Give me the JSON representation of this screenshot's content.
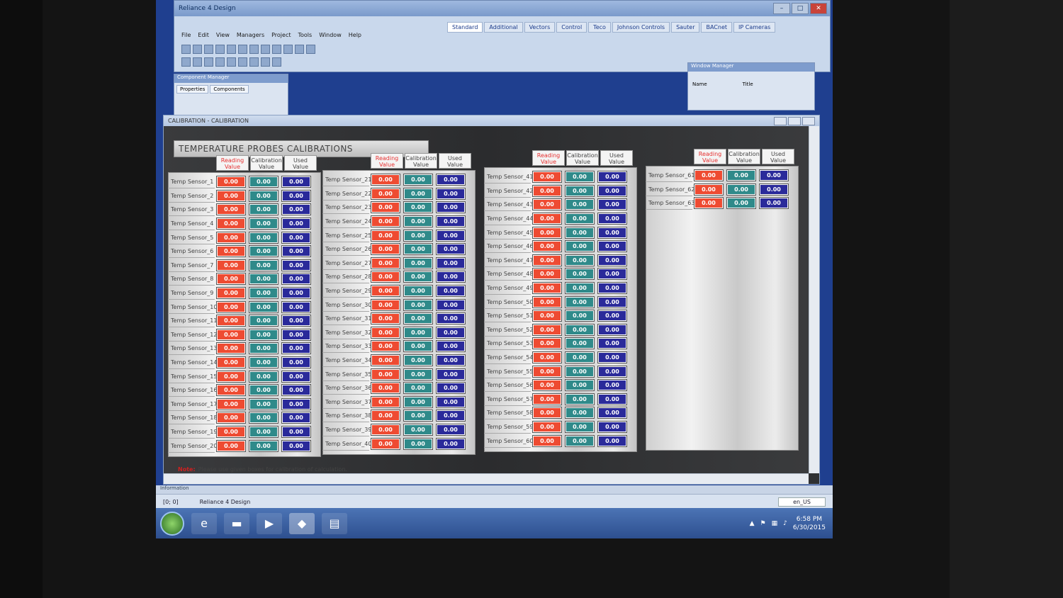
{
  "app": {
    "title": "Reliance 4 Design",
    "menu": [
      "File",
      "Edit",
      "View",
      "Managers",
      "Project",
      "Tools",
      "Window",
      "Help"
    ],
    "palette_tabs": [
      "Standard",
      "Additional",
      "Vectors",
      "Control",
      "Tecо",
      "Johnson Controls",
      "Sauter",
      "BACnet",
      "IP Cameras"
    ]
  },
  "component_panel": {
    "title": "Component Manager",
    "tabs": [
      "Properties",
      "Components"
    ]
  },
  "window_manager": {
    "title": "Window Manager",
    "col_name": "Name",
    "col_title": "Title"
  },
  "calibration_window": {
    "title": "CALIBRATION - CALIBRATION",
    "heading": "TEMPERATURE PROBES CALIBRATIONS",
    "col_reading": "Reading Value",
    "col_calibration": "Calibration Value",
    "col_used": "Used Value",
    "note_label": "Note:",
    "note_text": "Please use given boxes for calibration of calculation.",
    "sensor_prefix": "Temp Sensor_",
    "value": "0.00",
    "group_counts": [
      20,
      20,
      20,
      3
    ]
  },
  "info_panel": {
    "label": "Information"
  },
  "status": {
    "coords": "[0; 0]",
    "app_name": "Reliance 4 Design",
    "language": "en_US"
  },
  "taskbar": {
    "time": "6:58 PM",
    "date": "6/30/2015"
  }
}
